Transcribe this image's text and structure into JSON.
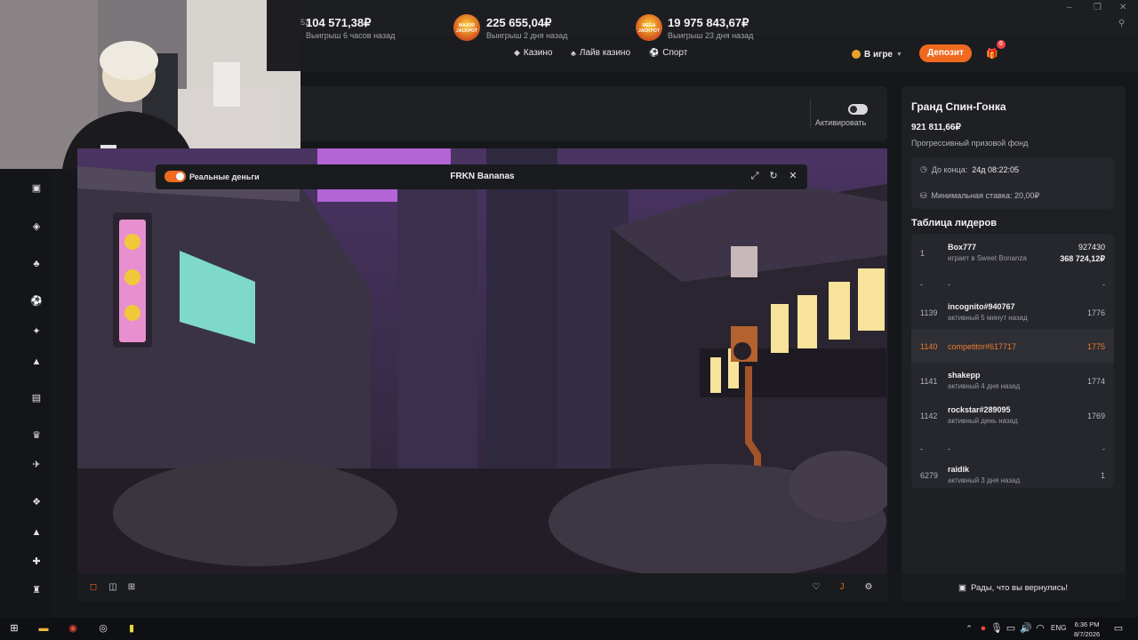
{
  "browser": {
    "address_fragment": "52"
  },
  "nav": {
    "casino": "Казино",
    "live_casino": "Лайв казино",
    "sport": "Спорт",
    "in_game": "В игре",
    "deposit": "Депозит",
    "gift_badge": "6"
  },
  "jackpots": [
    {
      "amount": "104 571,38₽",
      "sub": "Выигрыш 6 часов назад",
      "badge": ""
    },
    {
      "amount": "225 655,04₽",
      "sub": "Выигрыш 2 дня назад",
      "badge": "MAJOR JACKPOT"
    },
    {
      "amount": "19 975 843,67₽",
      "sub": "Выигрыш 23 дня назад",
      "badge": "MEGA JACKPOT"
    }
  ],
  "activate_label": "Активировать",
  "game": {
    "real_money_label": "Реальные деньги",
    "title": "FRKN Bananas"
  },
  "race": {
    "title": "Гранд Спин-Гонка",
    "prize": "921 811,66₽",
    "prize_sub": "Прогрессивный призовой фонд",
    "ends_label": "До конца:",
    "ends_value": "24д  08:22:05",
    "min_bet": "Минимальная ставка: 20,00₽"
  },
  "leaderboard": {
    "title": "Таблица лидеров",
    "first": {
      "rank": "1",
      "name": "Box777",
      "status": "играет в Sweet Bonanza",
      "score": "927430",
      "prize": "368 724,12₽"
    },
    "rows": [
      {
        "rank": "-",
        "name": "-",
        "status": "",
        "score": "-"
      },
      {
        "rank": "1139",
        "name": "incognito#940767",
        "status": "активный 5 минут назад",
        "score": "1776"
      },
      {
        "rank": "1140",
        "name": "competitor#617717",
        "status": "",
        "score": "1775"
      },
      {
        "rank": "1141",
        "name": "shakepp",
        "status": "активный 4 дня назад",
        "score": "1774"
      },
      {
        "rank": "1142",
        "name": "rockstar#289095",
        "status": "активный день назад",
        "score": "1769"
      },
      {
        "rank": "-",
        "name": "-",
        "status": "",
        "score": "-"
      },
      {
        "rank": "6279",
        "name": "raidik",
        "status": "активный 3 дня назад",
        "score": "1"
      }
    ]
  },
  "welcome": "Рады, что вы вернулись!",
  "taskbar": {
    "lang": "ENG",
    "time": "6:36 PM",
    "date": "8/7/2026"
  }
}
